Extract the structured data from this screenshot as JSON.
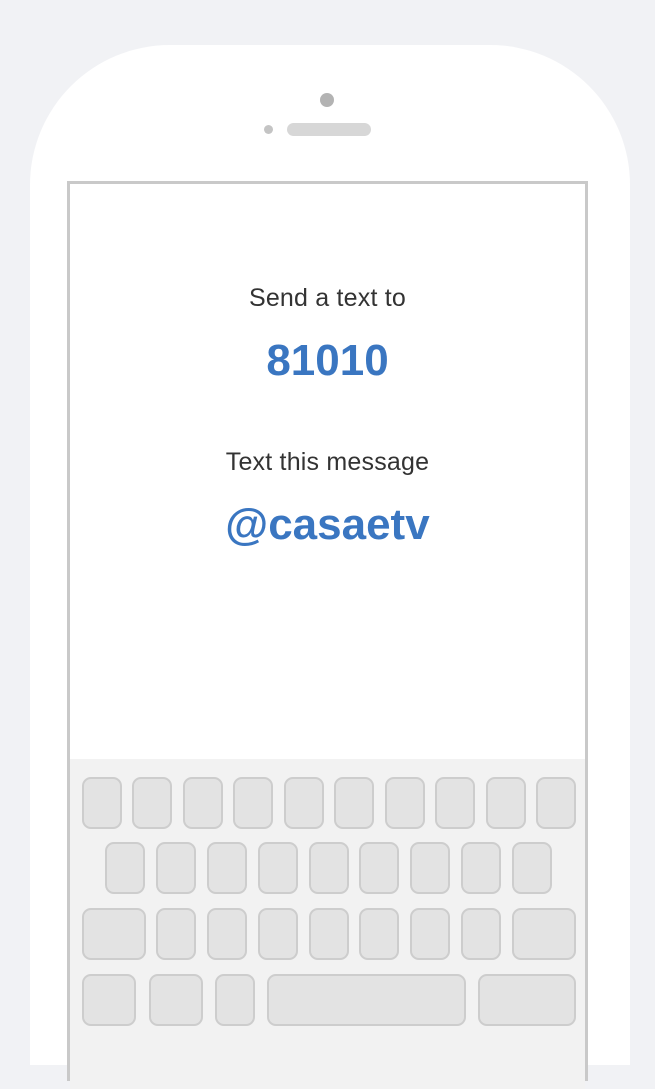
{
  "screen": {
    "send_label": "Send a text to",
    "number": "81010",
    "message_label": "Text this message",
    "message": "@casaetv"
  },
  "colors": {
    "accent": "#3a76c1",
    "background": "#f1f2f5",
    "phone": "#ffffff",
    "key": "#e3e3e3"
  }
}
